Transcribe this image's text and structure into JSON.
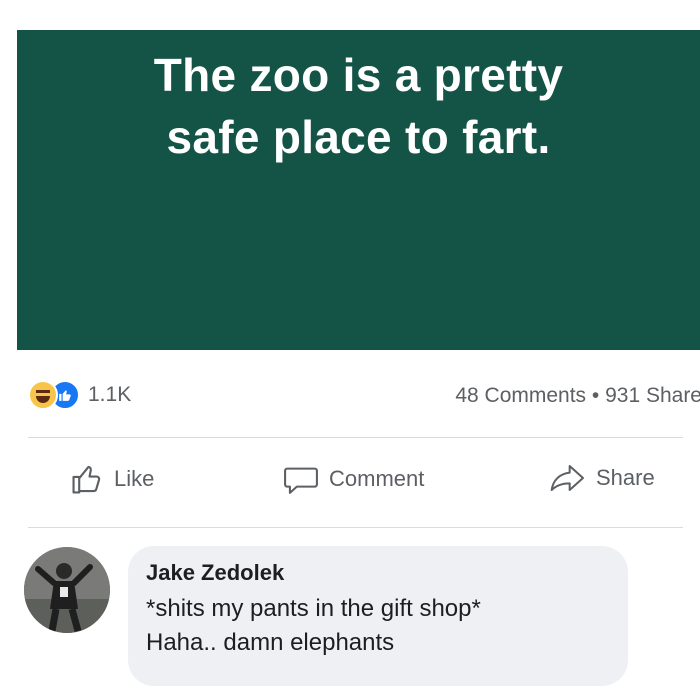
{
  "post": {
    "background_color": "#145447",
    "text": "The zoo is a pretty\nsafe place to fart."
  },
  "stats": {
    "reaction_icons": [
      "haha-reaction-icon",
      "like-reaction-icon"
    ],
    "reaction_count": "1.1K",
    "comments_shares": "48 Comments • 931 Share"
  },
  "actions": {
    "like_label": "Like",
    "comment_label": "Comment",
    "share_label": "Share"
  },
  "comment": {
    "author": "Jake Zedolek",
    "line1": "*shits my pants in the gift shop*",
    "line2": "Haha.. damn elephants"
  }
}
